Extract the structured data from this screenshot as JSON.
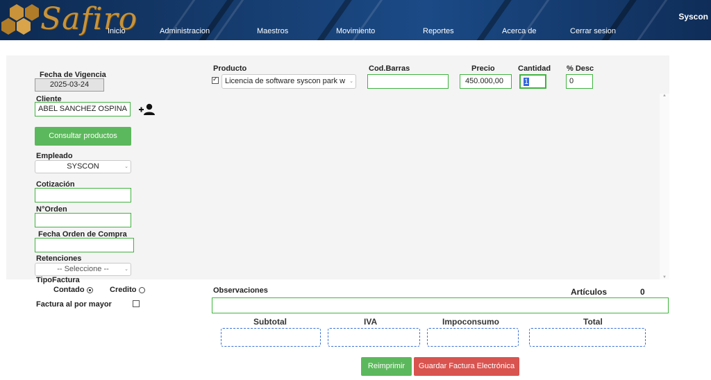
{
  "header": {
    "brand": "Safiro",
    "nav": [
      "Inicio",
      "Administracion",
      "Maestros",
      "Movimiento",
      "Reportes",
      "Acerca de",
      "Cerrar sesion"
    ],
    "user": "Syscon"
  },
  "left": {
    "fecha_vigencia_label": "Fecha de Vigencia",
    "fecha_vigencia_value": "2025-03-24",
    "cliente_label": "Cliente",
    "cliente_value": "ABEL SANCHEZ OSPINA",
    "consultar_button": "Consultar productos",
    "empleado_label": "Empleado",
    "empleado_value": "SYSCON",
    "cotizacion_label": "Cotización",
    "orden_label": "N°Orden",
    "fecha_orden_label": "Fecha Orden de Compra",
    "retenciones_label": "Retenciones",
    "retenciones_value": "-- Seleccione --",
    "tipo_factura_label": "TipoFactura",
    "contado_label": "Contado",
    "credito_label": "Credito",
    "por_mayor_label": "Factura al por mayor"
  },
  "product": {
    "producto_label": "Producto",
    "producto_value": "Licencia de software syscon park w",
    "codbarras_label": "Cod.Barras",
    "precio_label": "Precio",
    "precio_value": "450.000,00",
    "cantidad_label": "Cantidad",
    "cantidad_value": "1",
    "desc_label": "% Desc",
    "desc_value": "0"
  },
  "bottom": {
    "observaciones_label": "Observaciones",
    "articulos_label": "Artículos",
    "articulos_value": "0",
    "subtotal_label": "Subtotal",
    "iva_label": "IVA",
    "impoconsumo_label": "Impoconsumo",
    "total_label": "Total",
    "reimprimir_button": "Reimprimir",
    "guardar_button": "Guardar Factura Electrónica"
  },
  "colors": {
    "header_bg": "#163d70",
    "brand_gold": "#c8933a",
    "input_border": "#3fb33f",
    "button_green": "#5cb85c",
    "button_red": "#d9534f",
    "total_border": "#3a70d6"
  }
}
